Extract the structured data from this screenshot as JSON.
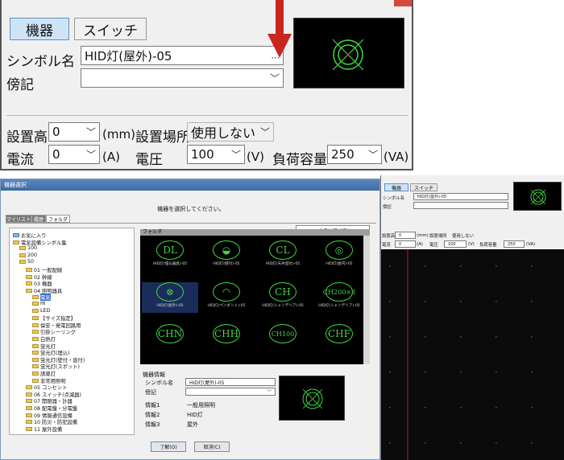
{
  "top_panel": {
    "tabs": [
      "機器",
      "スイッチ"
    ],
    "symbol_name_label": "シンボル名",
    "symbol_name_value": "HID灯(屋外)-05",
    "browse_label": "...",
    "annotation_label": "傍記",
    "annotation_value": "",
    "install_height_label": "設置高",
    "install_height_value": "0",
    "install_height_unit": "(mm)",
    "install_place_label": "設置場所",
    "install_place_value": "使用しない",
    "current_label": "電流",
    "current_value": "0",
    "current_unit": "(A)",
    "voltage_label": "電圧",
    "voltage_value": "100",
    "voltage_unit": "(V)",
    "load_label": "負荷容量",
    "load_value": "250",
    "load_unit": "(VA)"
  },
  "dialog": {
    "title": "機器選択",
    "instruction": "機器を選択してください。",
    "tabs": [
      "マイリスト",
      "履歴",
      "フォルダ"
    ],
    "view_toggle": "大きいアイコン",
    "folder_header": "フォルダ",
    "tree": [
      {
        "label": "お気に入り",
        "level": 0
      },
      {
        "label": "電気設備シンボル集",
        "level": 0
      },
      {
        "label": "100",
        "level": 1
      },
      {
        "label": "200",
        "level": 1
      },
      {
        "label": "50",
        "level": 1
      },
      {
        "label": "01 一般配線",
        "level": 2
      },
      {
        "label": "02 幹線",
        "level": 2
      },
      {
        "label": "03 機器",
        "level": 2
      },
      {
        "label": "04 照明器具",
        "level": 2
      },
      {
        "label": "電気",
        "level": 3
      },
      {
        "label": "HI",
        "level": 3
      },
      {
        "label": "LED",
        "level": 3
      },
      {
        "label": "【サイズ指定】",
        "level": 3
      },
      {
        "label": "保安・発電回路用",
        "level": 3
      },
      {
        "label": "引掛シーリング",
        "level": 3
      },
      {
        "label": "白熱灯",
        "level": 3
      },
      {
        "label": "蛍光灯",
        "level": 3
      },
      {
        "label": "蛍光灯(埋込)",
        "level": 3
      },
      {
        "label": "蛍光灯(壁付・直付)",
        "level": 3
      },
      {
        "label": "蛍光灯(スポット)",
        "level": 3
      },
      {
        "label": "誘導灯",
        "level": 3
      },
      {
        "label": "非常用照明",
        "level": 3
      },
      {
        "label": "05 コンセント",
        "level": 2
      },
      {
        "label": "06 スイッチ(点滅器)",
        "level": 2
      },
      {
        "label": "07 開閉器・計器",
        "level": 2
      },
      {
        "label": "08 配電盤・分電盤",
        "level": 2
      },
      {
        "label": "09 情報通信設備",
        "level": 2
      },
      {
        "label": "10 防災・防犯設備",
        "level": 2
      },
      {
        "label": "11 屋外設備",
        "level": 2
      }
    ],
    "symbols": [
      {
        "glyph": "DL",
        "label": "HID灯(埋込器具)-05"
      },
      {
        "glyph": "◒",
        "label": "HID灯(壁付)-05"
      },
      {
        "glyph": "CL",
        "label": "HID灯(天井直付)-05"
      },
      {
        "glyph": "◎",
        "label": "HID灯(屋内)-05"
      },
      {
        "glyph": "⊗",
        "label": "HID灯(屋外)-05"
      },
      {
        "glyph": "◠",
        "label": "HID灯(ペンダント)-05"
      },
      {
        "glyph": "CH",
        "label": "HID灯(シャンデリア)-05"
      },
      {
        "glyph": "CH200×3",
        "label": "HID灯(シャンデリア)-05"
      },
      {
        "glyph": "CHN",
        "label": ""
      },
      {
        "glyph": "CHH",
        "label": ""
      },
      {
        "glyph": "CH100",
        "label": ""
      },
      {
        "glyph": "CHF",
        "label": ""
      }
    ],
    "info": {
      "header": "機器情報",
      "symbol_name_label": "シンボル名",
      "symbol_name_value": "HID灯(屋外)-05",
      "annotation_label": "傍記",
      "info1_label": "情報1",
      "info1_value": "一般用照明",
      "info2_label": "情報2",
      "info2_value": "HID灯",
      "info3_label": "情報3",
      "info3_value": "屋外"
    },
    "ok_button": "了解(O)",
    "cancel_button": "取消(C)"
  },
  "right_window": {
    "tabs": [
      "機器",
      "スイッチ"
    ],
    "symbol_name_label": "シンボル名",
    "symbol_name_value": "HID灯(屋外)-05",
    "annotation_label": "傍記",
    "install_height_label": "設置高",
    "install_height_value": "0",
    "install_height_unit": "(mm)",
    "install_place_label": "設置場所",
    "install_place_value": "使用しない",
    "current_label": "電流",
    "current_value": "0",
    "current_unit": "(A)",
    "voltage_label": "電圧",
    "voltage_value": "100",
    "voltage_unit": "(V)",
    "load_label": "負荷容量",
    "load_value": "250",
    "load_unit": "(VA)"
  },
  "colors": {
    "accent_red": "#c8261f",
    "symbol_green": "#42d642",
    "title_blue": "#4a78b2"
  }
}
